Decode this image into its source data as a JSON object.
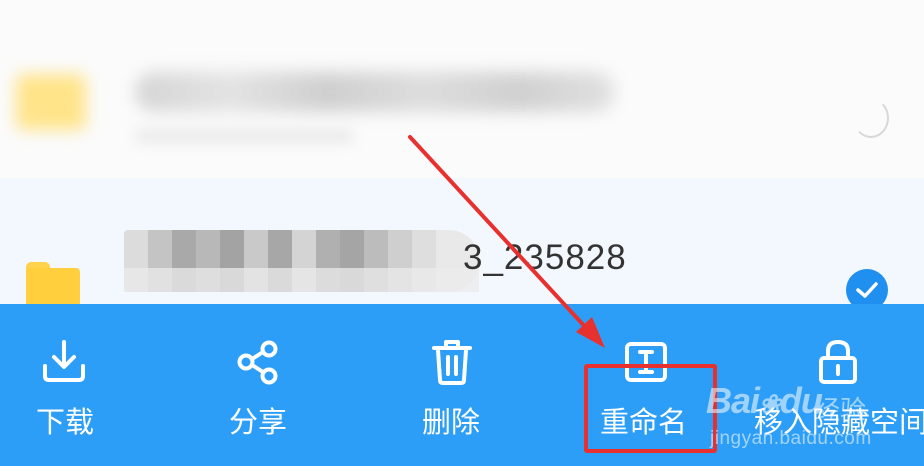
{
  "file_list": {
    "selected_item": {
      "name_visible_suffix": "3_235828"
    }
  },
  "action_bar": {
    "actions": [
      {
        "id": "download",
        "label": "下载",
        "icon": "download-icon"
      },
      {
        "id": "share",
        "label": "分享",
        "icon": "share-icon"
      },
      {
        "id": "delete",
        "label": "删除",
        "icon": "trash-icon"
      },
      {
        "id": "rename",
        "label": "重命名",
        "icon": "rename-icon"
      },
      {
        "id": "move-to-hidden",
        "label": "移入隐藏空间",
        "icon": "lock-icon"
      }
    ]
  },
  "colors": {
    "action_bar_bg": "#2d9ef7",
    "selected_row_bg": "#f2f8fe",
    "check_color": "#1f8ff0",
    "annotation_red": "#e8302f",
    "folder_yellow": "#ffcf3d"
  },
  "watermark": {
    "brand_text": "Bai",
    "brand_suffix": "du",
    "sub_text": "经验",
    "url": "jingyan.baidu.com"
  }
}
